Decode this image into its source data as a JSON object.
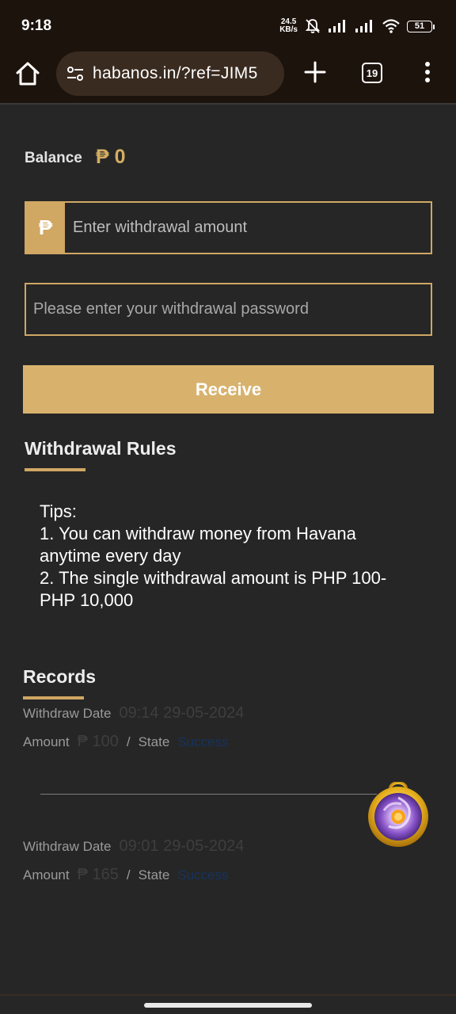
{
  "status_bar": {
    "time": "9:18",
    "net_speed_value": "24.5",
    "net_speed_unit": "KB/s",
    "battery": "51"
  },
  "browser": {
    "url": "habanos.in/?ref=JIM5",
    "tab_count": "19"
  },
  "balance": {
    "label": "Balance",
    "value": "₱ 0"
  },
  "form": {
    "currency_symbol": "₱",
    "amount_placeholder": "Enter withdrawal amount",
    "password_placeholder": "Please enter your withdrawal password",
    "receive_label": "Receive"
  },
  "rules": {
    "title": "Withdrawal Rules",
    "tips_heading": "Tips:",
    "tip_1": "1. You can withdraw money from Havana anytime every day",
    "tip_2": "2. The single withdrawal amount is PHP 100-PHP 10,000"
  },
  "records": {
    "title": "Records",
    "items": [
      {
        "date_label": "Withdraw Date",
        "date": "09:14 29-05-2024",
        "amount_label": "Amount",
        "amount": "₱ 100",
        "separator": "/",
        "state_label": "State",
        "state": "Success"
      },
      {
        "date_label": "Withdraw Date",
        "date": "09:01 29-05-2024",
        "amount_label": "Amount",
        "amount": "₱ 165",
        "separator": "/",
        "state_label": "State",
        "state": "Success"
      }
    ]
  },
  "colors": {
    "accent": "#d0a763",
    "button": "#d8b26d",
    "background": "#262626",
    "browser_bar": "#1d130d",
    "state_text": "#16335e"
  },
  "icons": [
    "home-icon",
    "site-settings-icon",
    "plus-icon",
    "tabs-icon",
    "more-vert-icon",
    "mute-icon",
    "signal-icon",
    "wifi-icon",
    "battery-icon",
    "game-orb-icon"
  ]
}
